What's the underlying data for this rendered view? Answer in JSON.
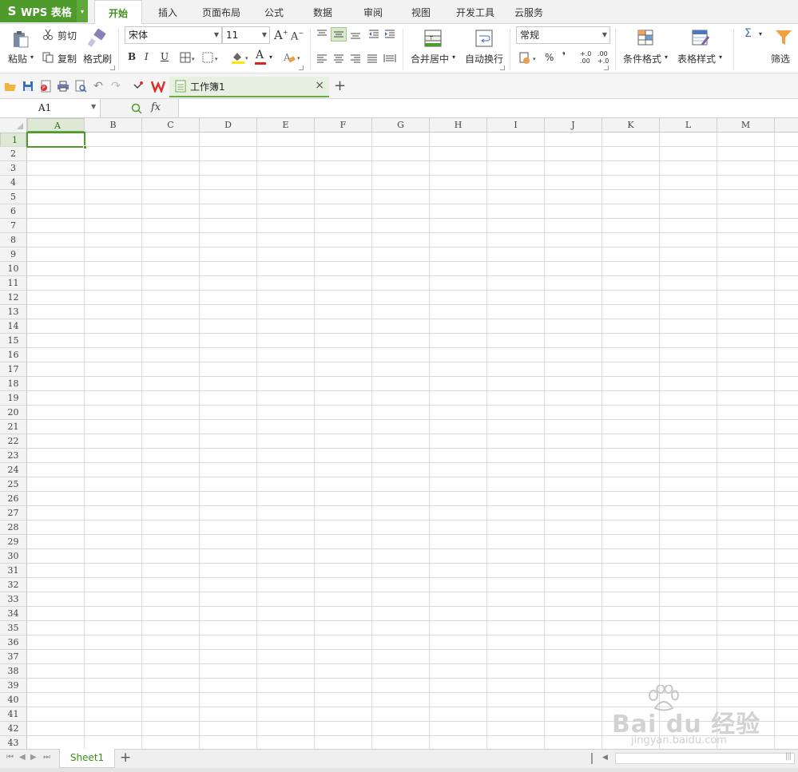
{
  "app": {
    "logo_glyph": "S",
    "name": "WPS 表格",
    "menu_arrow": "▾",
    "accent_color": "#4e9a2b"
  },
  "menu": {
    "tabs": [
      "开始",
      "插入",
      "页面布局",
      "公式",
      "数据",
      "审阅",
      "视图",
      "开发工具",
      "云服务"
    ],
    "active_tab": "开始"
  },
  "ribbon": {
    "clipboard": {
      "paste": "粘贴",
      "cut": "剪切",
      "copy": "复制",
      "format_painter": "格式刷"
    },
    "font": {
      "name": "宋体",
      "size": "11",
      "bold": "B",
      "italic": "I",
      "underline": "U",
      "font_color_glyph": "A"
    },
    "align": {
      "merge_center": "合并居中",
      "wrap_text": "自动换行"
    },
    "number": {
      "format": "常规",
      "percent": "%",
      "comma": "❜",
      "inc_decimal": "+.0 .00",
      "dec_decimal": ".00 +.0"
    },
    "styles": {
      "conditional_format": "条件格式",
      "table_style": "表格样式"
    },
    "editing": {
      "sum_glyph": "Σ",
      "filter": "筛选"
    }
  },
  "document_tab": {
    "title": "工作簿1",
    "close_glyph": "×",
    "add_glyph": "+"
  },
  "formula_bar": {
    "cell_ref": "A1",
    "fx_label": "fx",
    "formula": ""
  },
  "sheet": {
    "columns": [
      "A",
      "B",
      "C",
      "D",
      "E",
      "F",
      "G",
      "H",
      "I",
      "J",
      "K",
      "L",
      "M"
    ],
    "rows": [
      "1",
      "2",
      "3",
      "4",
      "5",
      "6",
      "7",
      "8",
      "9",
      "10",
      "11",
      "12",
      "13",
      "14",
      "15",
      "16",
      "17",
      "18",
      "19",
      "20",
      "21",
      "22",
      "23",
      "24",
      "25",
      "26",
      "27",
      "28",
      "29",
      "30",
      "31",
      "32",
      "33",
      "34",
      "35",
      "36",
      "37",
      "38",
      "39",
      "40",
      "41",
      "42",
      "43"
    ],
    "selected_column": "A",
    "selected_row": "1"
  },
  "sheet_tabs": {
    "tabs": [
      "Sheet1"
    ],
    "add_glyph": "+"
  },
  "watermark": {
    "brand": "Bai du 经验",
    "url": "jingyan.baidu.com"
  }
}
